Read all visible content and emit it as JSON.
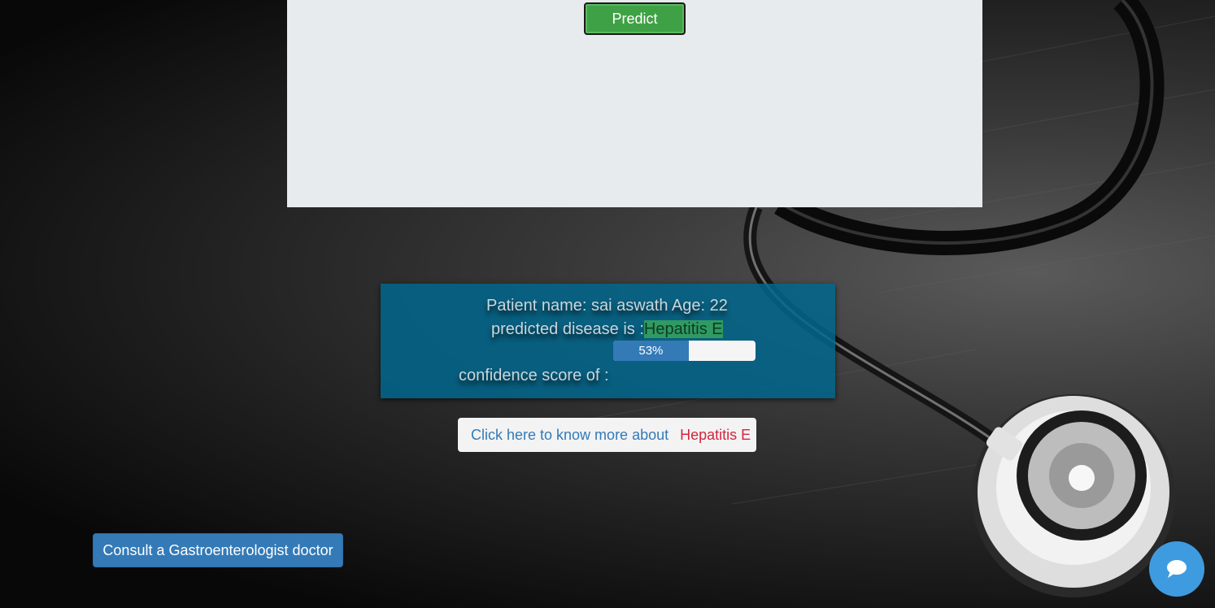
{
  "form": {
    "predict_label": "Predict"
  },
  "result": {
    "patient_line": "Patient name: sai aswath Age: 22",
    "disease_prefix": "predicted disease is :",
    "disease_name": "Hepatitis E",
    "progress_label": "53%",
    "progress_value": 0.53,
    "confidence_label": "confidence score of :"
  },
  "more_info": {
    "text": "Click here to know more about",
    "disease": "Hepatitis E"
  },
  "consult": {
    "label": "Consult a Gastroenterologist doctor"
  },
  "chat": {
    "icon": "chat-bubble-icon"
  },
  "colors": {
    "predict_green": "#3fa145",
    "result_blue": "#01668c",
    "primary_blue": "#337ab7",
    "disease_red": "#d3263e",
    "chat_blue": "#3f9be0"
  }
}
